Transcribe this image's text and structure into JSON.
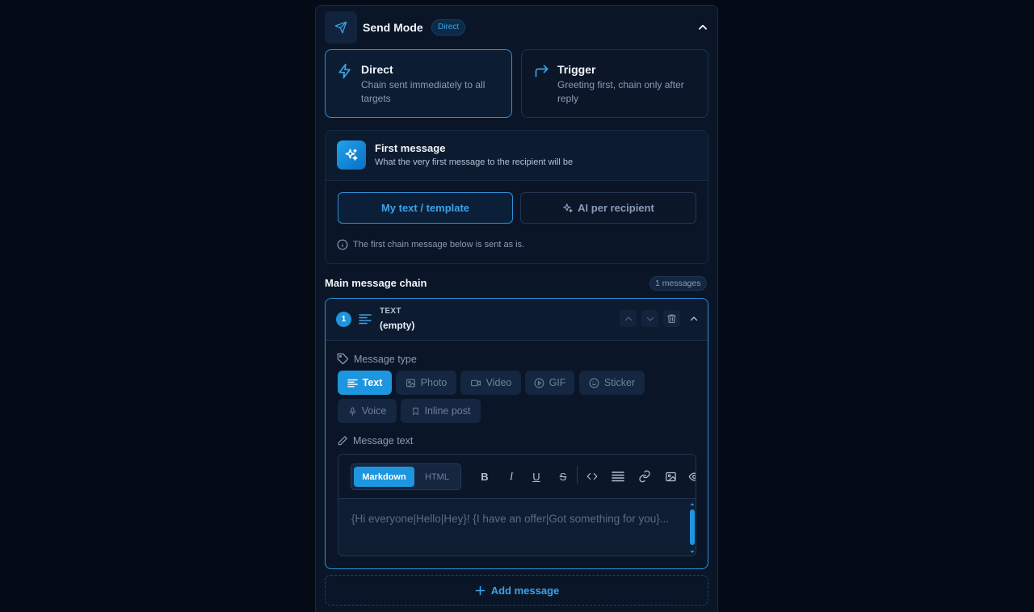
{
  "send_mode": {
    "title": "Send Mode",
    "badge": "Direct",
    "options": [
      {
        "title": "Direct",
        "description": "Chain sent immediately to all targets"
      },
      {
        "title": "Trigger",
        "description": "Greeting first, chain only after reply"
      }
    ]
  },
  "first_message": {
    "title": "First message",
    "subtitle": "What the very first message to the recipient will be",
    "option_template": "My text / template",
    "option_ai": "AI per recipient",
    "info": "The first chain message below is sent as is."
  },
  "chain": {
    "title": "Main message chain",
    "count": "1 messages"
  },
  "message": {
    "number": "1",
    "type_label": "TEXT",
    "preview": "(empty)",
    "message_type_label": "Message type",
    "types": [
      "Text",
      "Photo",
      "Video",
      "GIF",
      "Sticker",
      "Voice",
      "Inline post"
    ],
    "message_text_label": "Message text",
    "format_markdown": "Markdown",
    "format_html": "HTML",
    "toolbar": {
      "bold": "B",
      "italic": "I",
      "underline": "U",
      "strike": "S"
    },
    "placeholder": "{Hi everyone|Hello|Hey}! {I have an offer|Got something for you}..."
  },
  "add_message": "Add message",
  "colors": {
    "accent": "#1e96df",
    "background": "#050b16",
    "panel": "#0a1628"
  }
}
